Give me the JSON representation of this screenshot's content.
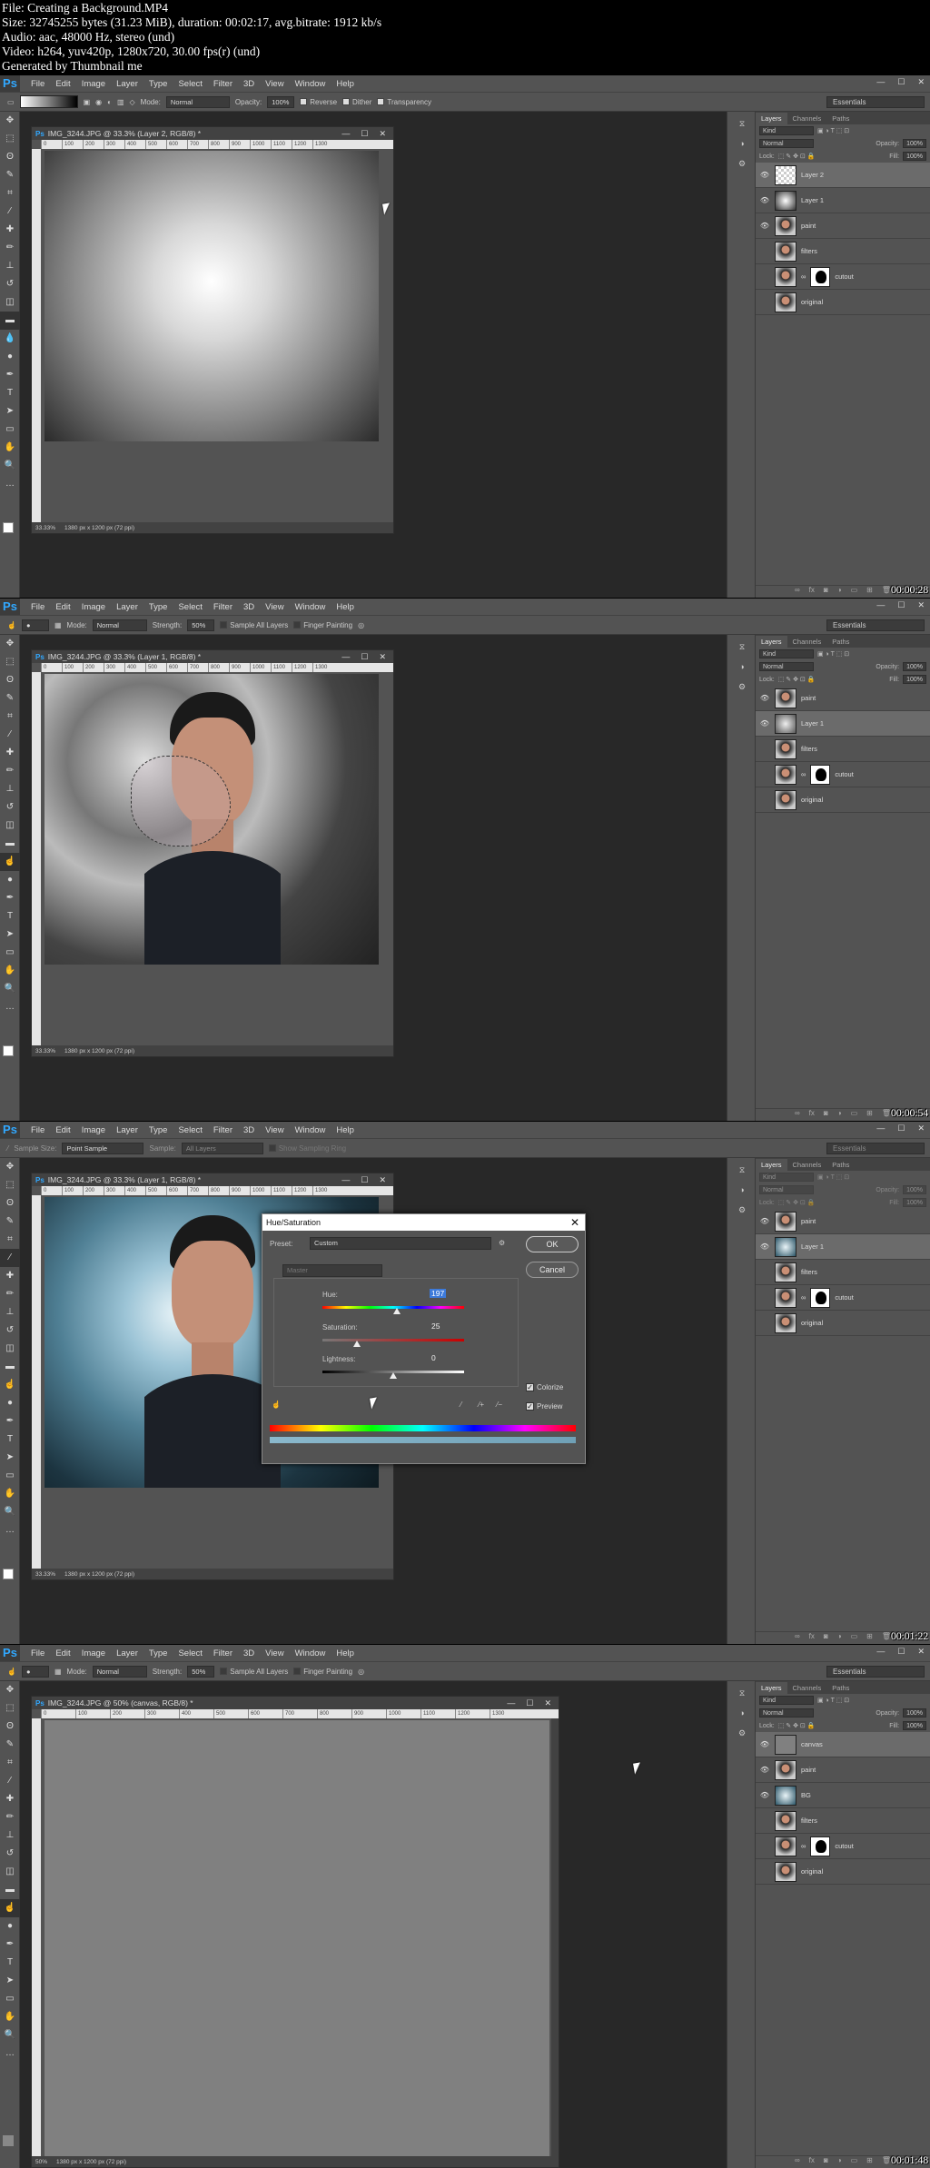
{
  "header": {
    "lines": [
      "File: Creating a Background.MP4",
      "Size: 32745255 bytes (31.23 MiB), duration: 00:02:17, avg.bitrate: 1912 kb/s",
      "Audio: aac, 48000 Hz, stereo (und)",
      "Video: h264, yuv420p, 1280x720, 30.00 fps(r) (und)",
      "Generated by Thumbnail me"
    ]
  },
  "menu": [
    "File",
    "Edit",
    "Image",
    "Layer",
    "Type",
    "Select",
    "Filter",
    "3D",
    "View",
    "Window",
    "Help"
  ],
  "workspace": "Essentials",
  "tabs": [
    "Layers",
    "Channels",
    "Paths"
  ],
  "layer_panel": {
    "kind": "Kind",
    "blend": "Normal",
    "opacity_label": "Opacity:",
    "opacity": "100%",
    "lock_label": "Lock:",
    "fill_label": "Fill:",
    "fill": "100%"
  },
  "frames": [
    {
      "timestamp": "00:00:28",
      "options": {
        "mode_label": "Mode:",
        "mode": "Normal",
        "opacity_label": "Opacity:",
        "opacity": "100%",
        "reverse": "Reverse",
        "dither": "Dither",
        "transparency": "Transparency"
      },
      "doc": {
        "title": "IMG_3244.JPG @ 33.3% (Layer 2, RGB/8) *",
        "zoom": "33.33%",
        "size": "1380 px x 1200 px (72 ppi)"
      },
      "layers": [
        {
          "name": "Layer 2",
          "selected": true
        },
        {
          "name": "Layer 1",
          "selected": false
        },
        {
          "name": "paint",
          "selected": false
        },
        {
          "name": "filters",
          "selected": false
        },
        {
          "name": "cutout",
          "selected": false
        },
        {
          "name": "original",
          "selected": false
        }
      ]
    },
    {
      "timestamp": "00:00:54",
      "options": {
        "mode_label": "Mode:",
        "mode": "Normal",
        "strength_label": "Strength:",
        "strength": "50%",
        "sample": "Sample All Layers",
        "finger": "Finger Painting"
      },
      "doc": {
        "title": "IMG_3244.JPG @ 33.3% (Layer 1, RGB/8) *",
        "zoom": "33.33%",
        "size": "1380 px x 1200 px (72 ppi)"
      },
      "layers": [
        {
          "name": "paint",
          "selected": false
        },
        {
          "name": "Layer 1",
          "selected": true
        },
        {
          "name": "filters",
          "selected": false
        },
        {
          "name": "cutout",
          "selected": false
        },
        {
          "name": "original",
          "selected": false
        }
      ]
    },
    {
      "timestamp": "00:01:22",
      "options": {
        "sample_size_label": "Sample Size:",
        "sample_size": "Point Sample",
        "sample_label": "Sample:",
        "sample": "All Layers",
        "show_ring": "Show Sampling Ring"
      },
      "doc": {
        "title": "IMG_3244.JPG @ 33.3% (Layer 1, RGB/8) *",
        "zoom": "33.33%",
        "size": "1380 px x 1200 px (72 ppi)"
      },
      "layers": [
        {
          "name": "paint",
          "selected": false
        },
        {
          "name": "Layer 1",
          "selected": true
        },
        {
          "name": "filters",
          "selected": false
        },
        {
          "name": "cutout",
          "selected": false
        },
        {
          "name": "original",
          "selected": false
        }
      ],
      "dialog": {
        "title": "Hue/Saturation",
        "preset_label": "Preset:",
        "preset": "Custom",
        "ok": "OK",
        "cancel": "Cancel",
        "channel": "Master",
        "hue_label": "Hue:",
        "hue": "197",
        "saturation_label": "Saturation:",
        "saturation": "25",
        "lightness_label": "Lightness:",
        "lightness": "0",
        "colorize": "Colorize",
        "preview": "Preview"
      }
    },
    {
      "timestamp": "00:01:48",
      "options": {
        "mode_label": "Mode:",
        "mode": "Normal",
        "strength_label": "Strength:",
        "strength": "50%",
        "sample": "Sample All Layers",
        "finger": "Finger Painting"
      },
      "doc": {
        "title": "IMG_3244.JPG @ 50% (canvas, RGB/8) *",
        "zoom": "50%",
        "size": "1380 px x 1200 px (72 ppi)"
      },
      "layers": [
        {
          "name": "canvas",
          "selected": true
        },
        {
          "name": "paint",
          "selected": false
        },
        {
          "name": "BG",
          "selected": false
        },
        {
          "name": "filters",
          "selected": false
        },
        {
          "name": "cutout",
          "selected": false
        },
        {
          "name": "original",
          "selected": false
        }
      ]
    }
  ],
  "ruler_ticks": [
    "0",
    "100",
    "200",
    "300",
    "400",
    "500",
    "600",
    "700",
    "800",
    "900",
    "1000",
    "1100",
    "1200",
    "1300"
  ]
}
